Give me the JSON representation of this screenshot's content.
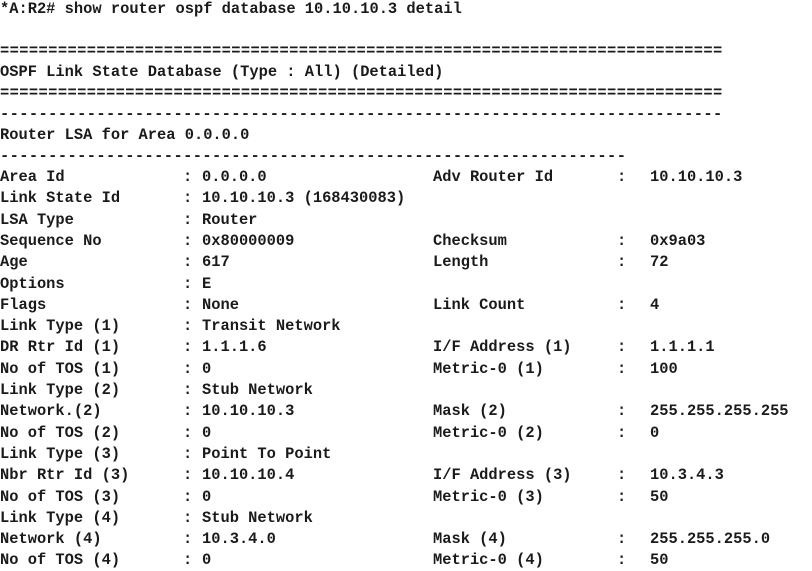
{
  "terminal": {
    "prompt": "*A:R2#",
    "command": "show router ospf database 10.10.10.3 detail",
    "double_rule": "===========================================================================",
    "single_rule_long": "---------------------------------------------------------------------------",
    "single_rule_short": "-----------------------------------------------------------------",
    "table_title": "OSPF Link State Database (Type : All) (Detailed)",
    "section_title": "Router LSA for Area 0.0.0.0",
    "colon": ":",
    "rows": [
      {
        "left_key": "Area Id",
        "left_val": "0.0.0.0",
        "right_key": "Adv Router Id",
        "right_val": "10.10.10.3"
      },
      {
        "left_key": "Link State Id",
        "left_val": "10.10.10.3 (168430083)",
        "right_key": "",
        "right_val": ""
      },
      {
        "left_key": "LSA Type",
        "left_val": "Router",
        "right_key": "",
        "right_val": ""
      },
      {
        "left_key": "Sequence No",
        "left_val": "0x80000009",
        "right_key": "Checksum",
        "right_val": "0x9a03"
      },
      {
        "left_key": "Age",
        "left_val": "617",
        "right_key": "Length",
        "right_val": "72"
      },
      {
        "left_key": "Options",
        "left_val": "E",
        "right_key": "",
        "right_val": ""
      },
      {
        "left_key": "Flags",
        "left_val": "None",
        "right_key": "Link Count",
        "right_val": "4"
      },
      {
        "left_key": "Link Type (1)",
        "left_val": "Transit Network",
        "right_key": "",
        "right_val": ""
      },
      {
        "left_key": "DR Rtr Id (1)",
        "left_val": "1.1.1.6",
        "right_key": "I/F Address (1)",
        "right_val": "1.1.1.1"
      },
      {
        "left_key": "No of TOS (1)",
        "left_val": "0",
        "right_key": "Metric-0 (1)",
        "right_val": "100"
      },
      {
        "left_key": "Link Type (2)",
        "left_val": "Stub Network",
        "right_key": "",
        "right_val": ""
      },
      {
        "left_key": "Network.(2)",
        "left_val": "10.10.10.3",
        "right_key": "Mask (2)",
        "right_val": "255.255.255.255"
      },
      {
        "left_key": "No of TOS (2)",
        "left_val": "0",
        "right_key": "Metric-0 (2)",
        "right_val": "0"
      },
      {
        "left_key": "Link Type (3)",
        "left_val": "Point To Point",
        "right_key": "",
        "right_val": ""
      },
      {
        "left_key": "Nbr Rtr Id (3)",
        "left_val": "10.10.10.4",
        "right_key": "I/F Address (3)",
        "right_val": "10.3.4.3"
      },
      {
        "left_key": "No of TOS (3)",
        "left_val": "0",
        "right_key": "Metric-0 (3)",
        "right_val": "50"
      },
      {
        "left_key": "Link Type (4)",
        "left_val": "Stub Network",
        "right_key": "",
        "right_val": ""
      },
      {
        "left_key": "Network (4)",
        "left_val": "10.3.4.0",
        "right_key": "Mask (4)",
        "right_val": "255.255.255.0"
      },
      {
        "left_key": "No of TOS (4)",
        "left_val": "0",
        "right_key": "Metric-0 (4)",
        "right_val": "50"
      }
    ]
  }
}
